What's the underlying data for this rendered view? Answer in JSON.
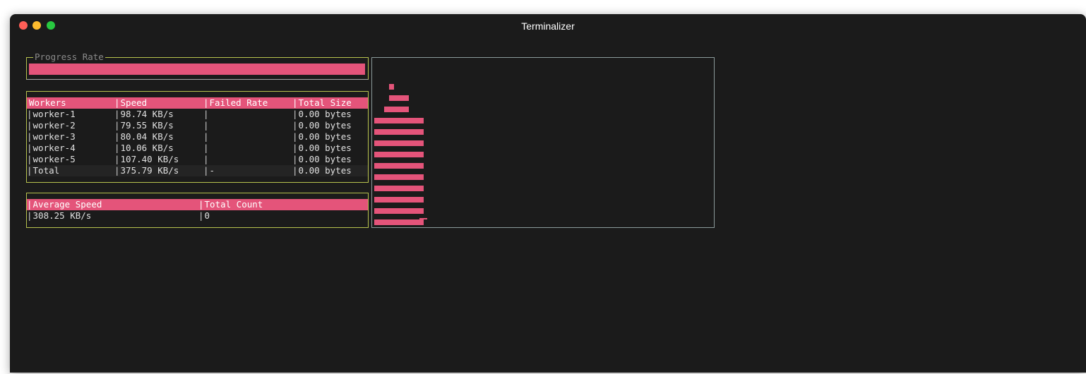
{
  "window": {
    "title": "Terminalizer"
  },
  "progress": {
    "label": "Progress Rate",
    "rate": 1.0,
    "color": "#e4547a"
  },
  "workers_table": {
    "headers": [
      "Workers",
      "Speed",
      "Failed Rate",
      "Total Size"
    ],
    "rows": [
      [
        "worker-1",
        "98.74 KB/s",
        "",
        "0.00 bytes"
      ],
      [
        "worker-2",
        "79.55 KB/s",
        "",
        "0.00 bytes"
      ],
      [
        "worker-3",
        "80.04 KB/s",
        "",
        "0.00 bytes"
      ],
      [
        "worker-4",
        "10.06 KB/s",
        "",
        "0.00 bytes"
      ],
      [
        "worker-5",
        "107.40 KB/s",
        "",
        "0.00 bytes"
      ]
    ],
    "total": [
      "Total",
      "375.79 KB/s",
      "-",
      "0.00 bytes"
    ]
  },
  "summary_table": {
    "headers": [
      "Average Speed",
      "Total Count"
    ],
    "values": [
      "308.25 KB/s",
      "0"
    ]
  },
  "histogram": {
    "color": "#e4547a",
    "max_units": 14,
    "bars": [
      10,
      10,
      11,
      13,
      12,
      12,
      12,
      10,
      10,
      10
    ]
  },
  "colors": {
    "accent": "#e4547a",
    "background": "#1b1b1b",
    "border": "#b7c24e"
  }
}
